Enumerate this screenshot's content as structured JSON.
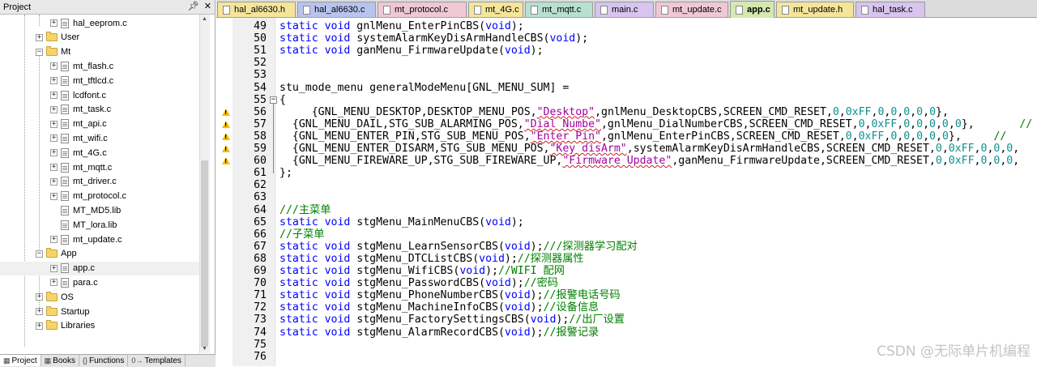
{
  "project_panel": {
    "title": "Project",
    "pin_icon": "pin-icon",
    "close_icon": "close-icon",
    "items": [
      {
        "label": "hal_eeprom.c",
        "kind": "file",
        "level": 3,
        "expander": "+"
      },
      {
        "label": "User",
        "kind": "folder",
        "level": 2,
        "expander": "+"
      },
      {
        "label": "Mt",
        "kind": "folder",
        "level": 2,
        "expander": "-"
      },
      {
        "label": "mt_flash.c",
        "kind": "file",
        "level": 3,
        "expander": "+"
      },
      {
        "label": "mt_tftlcd.c",
        "kind": "file",
        "level": 3,
        "expander": "+"
      },
      {
        "label": "lcdfont.c",
        "kind": "file",
        "level": 3,
        "expander": "+"
      },
      {
        "label": "mt_task.c",
        "kind": "file",
        "level": 3,
        "expander": "+"
      },
      {
        "label": "mt_api.c",
        "kind": "file",
        "level": 3,
        "expander": "+"
      },
      {
        "label": "mt_wifi.c",
        "kind": "file",
        "level": 3,
        "expander": "+"
      },
      {
        "label": "mt_4G.c",
        "kind": "file",
        "level": 3,
        "expander": "+"
      },
      {
        "label": "mt_mqtt.c",
        "kind": "file",
        "level": 3,
        "expander": "+"
      },
      {
        "label": "mt_driver.c",
        "kind": "file",
        "level": 3,
        "expander": "+"
      },
      {
        "label": "mt_protocol.c",
        "kind": "file",
        "level": 3,
        "expander": "+"
      },
      {
        "label": "MT_MD5.lib",
        "kind": "file",
        "level": 3,
        "expander": ""
      },
      {
        "label": "MT_lora.lib",
        "kind": "file",
        "level": 3,
        "expander": ""
      },
      {
        "label": "mt_update.c",
        "kind": "file",
        "level": 3,
        "expander": "+"
      },
      {
        "label": "App",
        "kind": "folder",
        "level": 2,
        "expander": "-"
      },
      {
        "label": "app.c",
        "kind": "file",
        "level": 3,
        "expander": "+",
        "selected": true
      },
      {
        "label": "para.c",
        "kind": "file",
        "level": 3,
        "expander": "+"
      },
      {
        "label": "OS",
        "kind": "folder",
        "level": 2,
        "expander": "+"
      },
      {
        "label": "Startup",
        "kind": "folder",
        "level": 2,
        "expander": "+"
      },
      {
        "label": "Libraries",
        "kind": "folder",
        "level": 2,
        "expander": "+"
      }
    ],
    "bottom_tabs": [
      {
        "label": "Project",
        "icon": "project-icon"
      },
      {
        "label": "Books",
        "icon": "books-icon"
      },
      {
        "label": "Functions",
        "icon": "functions-icon",
        "glyph": "{}"
      },
      {
        "label": "Templates",
        "icon": "templates-icon",
        "glyph": "0→"
      }
    ]
  },
  "editor_tabs": [
    {
      "label": "hal_al6630.h",
      "color": "#f5e59a"
    },
    {
      "label": "hal_al6630.c",
      "color": "#b8c4ee"
    },
    {
      "label": "mt_protocol.c",
      "color": "#f0c8d4"
    },
    {
      "label": "mt_4G.c",
      "color": "#f5e59a"
    },
    {
      "label": "mt_mqtt.c",
      "color": "#b8e0d0"
    },
    {
      "label": "main.c",
      "color": "#d8c4ee"
    },
    {
      "label": "mt_update.c",
      "color": "#f0c8d4"
    },
    {
      "label": "app.c",
      "color": "#d4e8b0",
      "active": true
    },
    {
      "label": "mt_update.h",
      "color": "#f5e59a"
    },
    {
      "label": "hal_task.c",
      "color": "#d8c4ee"
    }
  ],
  "code_lines": [
    {
      "n": "49",
      "tokens": [
        [
          "kw",
          "static void"
        ],
        [
          "",
          "gnlMenu_EnterPinCBS("
        ],
        [
          "kw",
          "void"
        ],
        [
          "",
          ");"
        ]
      ]
    },
    {
      "n": "50",
      "tokens": [
        [
          "kw",
          "static void"
        ],
        [
          "",
          "systemAlarmKeyDisArmHandleCBS("
        ],
        [
          "kw",
          "void"
        ],
        [
          "",
          ");"
        ]
      ]
    },
    {
      "n": "51",
      "tokens": [
        [
          "kw",
          "static void"
        ],
        [
          "",
          "ganMenu_FirmwareUpdate("
        ],
        [
          "kw",
          "void"
        ],
        [
          "",
          ");"
        ]
      ]
    },
    {
      "n": "52",
      "tokens": []
    },
    {
      "n": "53",
      "tokens": []
    },
    {
      "n": "54",
      "tokens": [
        [
          "",
          "stu_mode_menu generalModeMenu[GNL_MENU_SUM] ="
        ]
      ]
    },
    {
      "n": "55",
      "fold": "-",
      "tokens": [
        [
          "",
          "{"
        ]
      ]
    },
    {
      "n": "56",
      "warn": true,
      "tokens": [
        [
          "",
          "     {GNL_MENU_DESKTOP,DESKTOP_MENU_POS,"
        ],
        [
          "str sq",
          "\"Desktop\""
        ],
        [
          "",
          ",gnlMenu_DesktopCBS,SCREEN_CMD_RESET,"
        ],
        [
          "num",
          "0"
        ],
        [
          "",
          ","
        ],
        [
          "num",
          "0xFF"
        ],
        [
          "",
          ","
        ],
        [
          "num",
          "0"
        ],
        [
          "",
          ","
        ],
        [
          "num",
          "0"
        ],
        [
          "",
          ","
        ],
        [
          "num",
          "0"
        ],
        [
          "",
          ","
        ],
        [
          "num",
          "0"
        ],
        [
          "",
          ","
        ],
        [
          "num",
          "0"
        ],
        [
          "",
          "},"
        ]
      ]
    },
    {
      "n": "57",
      "warn": true,
      "tokens": [
        [
          "",
          "  {GNL_MENU_DAIL,STG_SUB_ALARMING_POS,"
        ],
        [
          "str sq",
          "\"Dial Numbe\""
        ],
        [
          "",
          ",gnlMenu_DialNumberCBS,SCREEN_CMD_RESET,"
        ],
        [
          "num",
          "0"
        ],
        [
          "",
          ","
        ],
        [
          "num",
          "0xFF"
        ],
        [
          "",
          ","
        ],
        [
          "num",
          "0"
        ],
        [
          "",
          ","
        ],
        [
          "num",
          "0"
        ],
        [
          "",
          ","
        ],
        [
          "num",
          "0"
        ],
        [
          "",
          ","
        ],
        [
          "num",
          "0"
        ],
        [
          "",
          ","
        ],
        [
          "num",
          "0"
        ],
        [
          "",
          "},       "
        ],
        [
          "cm",
          "//"
        ]
      ]
    },
    {
      "n": "58",
      "warn": true,
      "tokens": [
        [
          "",
          "  {GNL_MENU_ENTER_PIN,STG_SUB_MENU_POS,"
        ],
        [
          "str sq",
          "\"Enter Pin\""
        ],
        [
          "",
          ",gnlMenu_EnterPinCBS,SCREEN_CMD_RESET,"
        ],
        [
          "num",
          "0"
        ],
        [
          "",
          ","
        ],
        [
          "num",
          "0xFF"
        ],
        [
          "",
          ","
        ],
        [
          "num",
          "0"
        ],
        [
          "",
          ","
        ],
        [
          "num",
          "0"
        ],
        [
          "",
          ","
        ],
        [
          "num",
          "0"
        ],
        [
          "",
          ","
        ],
        [
          "num",
          "0"
        ],
        [
          "",
          ","
        ],
        [
          "num",
          "0"
        ],
        [
          "",
          "},     "
        ],
        [
          "cm",
          "//"
        ]
      ]
    },
    {
      "n": "59",
      "warn": true,
      "tokens": [
        [
          "",
          "  {GNL_MENU_ENTER_DISARM,STG_SUB_MENU_POS,"
        ],
        [
          "str sq",
          "\"Key disArm\""
        ],
        [
          "",
          ",systemAlarmKeyDisArmHandleCBS,SCREEN_CMD_RESET,"
        ],
        [
          "num",
          "0"
        ],
        [
          "",
          ","
        ],
        [
          "num",
          "0xFF"
        ],
        [
          "",
          ","
        ],
        [
          "num",
          "0"
        ],
        [
          "",
          ","
        ],
        [
          "num",
          "0"
        ],
        [
          "",
          ","
        ],
        [
          "num",
          "0"
        ],
        [
          "",
          ","
        ]
      ]
    },
    {
      "n": "60",
      "warn": true,
      "tokens": [
        [
          "",
          "  {GNL_MENU_FIREWARE_UP,STG_SUB_FIREWARE_UP,"
        ],
        [
          "str sq",
          "\"Firmware Update\""
        ],
        [
          "",
          ",ganMenu_FirmwareUpdate,SCREEN_CMD_RESET,"
        ],
        [
          "num",
          "0"
        ],
        [
          "",
          ","
        ],
        [
          "num",
          "0xFF"
        ],
        [
          "",
          ","
        ],
        [
          "num",
          "0"
        ],
        [
          "",
          ","
        ],
        [
          "num",
          "0"
        ],
        [
          "",
          ","
        ],
        [
          "num",
          "0"
        ],
        [
          "",
          ","
        ]
      ]
    },
    {
      "n": "61",
      "tokens": [
        [
          "",
          "};"
        ]
      ]
    },
    {
      "n": "62",
      "tokens": []
    },
    {
      "n": "63",
      "tokens": []
    },
    {
      "n": "64",
      "tokens": [
        [
          "cm",
          "///主菜单"
        ]
      ]
    },
    {
      "n": "65",
      "tokens": [
        [
          "kw",
          "static void"
        ],
        [
          "",
          "stgMenu_MainMenuCBS("
        ],
        [
          "kw",
          "void"
        ],
        [
          "",
          ");"
        ]
      ]
    },
    {
      "n": "66",
      "tokens": [
        [
          "cm",
          "//子菜单"
        ]
      ]
    },
    {
      "n": "67",
      "tokens": [
        [
          "kw",
          "static void"
        ],
        [
          "",
          "stgMenu_LearnSensorCBS("
        ],
        [
          "kw",
          "void"
        ],
        [
          "",
          ");"
        ],
        [
          "cm",
          "///探测器学习配对"
        ]
      ]
    },
    {
      "n": "68",
      "tokens": [
        [
          "kw",
          "static void"
        ],
        [
          "",
          "stgMenu_DTCListCBS("
        ],
        [
          "kw",
          "void"
        ],
        [
          "",
          ");"
        ],
        [
          "cm",
          "//探测器属性"
        ]
      ]
    },
    {
      "n": "69",
      "tokens": [
        [
          "kw",
          "static void"
        ],
        [
          "",
          "stgMenu_WifiCBS("
        ],
        [
          "kw",
          "void"
        ],
        [
          "",
          ");"
        ],
        [
          "cm",
          "//WIFI 配网"
        ]
      ]
    },
    {
      "n": "70",
      "tokens": [
        [
          "kw",
          "static void"
        ],
        [
          "",
          "stgMenu_PasswordCBS("
        ],
        [
          "kw",
          "void"
        ],
        [
          "",
          ");"
        ],
        [
          "cm",
          "//密码"
        ]
      ]
    },
    {
      "n": "71",
      "tokens": [
        [
          "kw",
          "static void"
        ],
        [
          "",
          "stgMenu_PhoneNumberCBS("
        ],
        [
          "kw",
          "void"
        ],
        [
          "",
          ");"
        ],
        [
          "cm",
          "//报警电话号码"
        ]
      ]
    },
    {
      "n": "72",
      "tokens": [
        [
          "kw",
          "static void"
        ],
        [
          "",
          "stgMenu_MachineInfoCBS("
        ],
        [
          "kw",
          "void"
        ],
        [
          "",
          ");"
        ],
        [
          "cm",
          "//设备信息"
        ]
      ]
    },
    {
      "n": "73",
      "tokens": [
        [
          "kw",
          "static void"
        ],
        [
          "",
          "stgMenu_FactorySettingsCBS("
        ],
        [
          "kw",
          "void"
        ],
        [
          "",
          ");"
        ],
        [
          "cm",
          "//出厂设置"
        ]
      ]
    },
    {
      "n": "74",
      "tokens": [
        [
          "kw",
          "static void"
        ],
        [
          "",
          "stgMenu_AlarmRecordCBS("
        ],
        [
          "kw",
          "void"
        ],
        [
          "",
          ");"
        ],
        [
          "cm",
          "//报警记录"
        ]
      ]
    },
    {
      "n": "75",
      "tokens": []
    },
    {
      "n": "76",
      "tokens": []
    }
  ],
  "watermark": "CSDN @无际单片机编程"
}
